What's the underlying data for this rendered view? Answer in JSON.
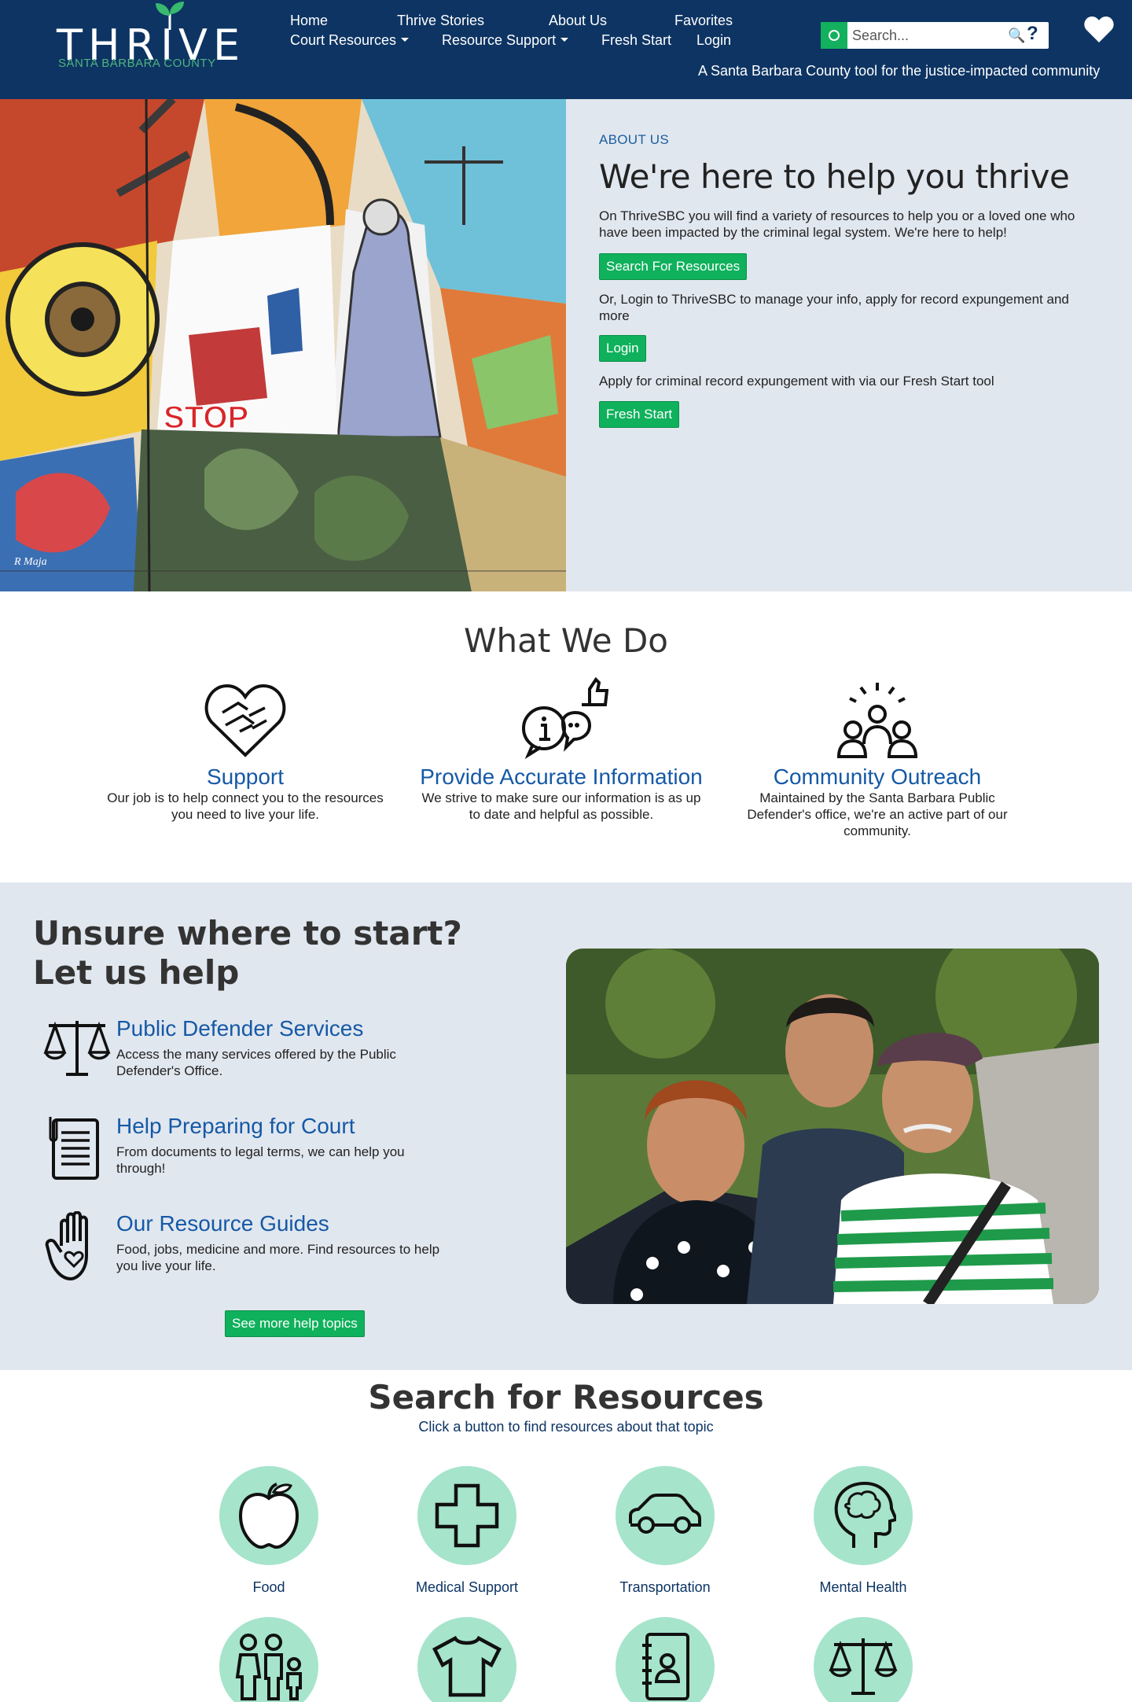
{
  "header": {
    "logo_word": "THRIVE",
    "logo_sub": "SANTA BARBARA COUNTY",
    "nav": {
      "home": "Home",
      "thrive_stories": "Thrive Stories",
      "about_us": "About Us",
      "favorites": "Favorites",
      "court_resources": "Court Resources",
      "resource_support": "Resource Support",
      "fresh_start": "Fresh Start",
      "login": "Login"
    },
    "search_placeholder": "Search...",
    "help_label": "?",
    "tagline": "A Santa Barbara County tool for the justice-impacted community"
  },
  "hero": {
    "mural_text": "STOP",
    "mural_signature": "R Maja",
    "eyebrow": "ABOUT US",
    "title": "We're here to help you thrive",
    "p1": "On ThriveSBC you will find a variety of resources to help you or a loved one who have been impacted by the criminal legal system. We're here to help!",
    "btn_search": "Search For Resources",
    "p2": "Or, Login to ThriveSBC to manage your info, apply for record expungement and more",
    "btn_login": "Login",
    "p3": "Apply for criminal record expungement with via our Fresh Start tool",
    "btn_fresh": "Fresh Start"
  },
  "what_we_do": {
    "title": "What We Do",
    "items": [
      {
        "heading": "Support",
        "text": "Our job is to help connect you to the resources you need to live your life.",
        "icon": "heart-hands-icon"
      },
      {
        "heading": "Provide Accurate Information",
        "text": "We strive to make sure our information is as up to date and helpful as possible.",
        "icon": "info-thumbs-up-icon"
      },
      {
        "heading": "Community Outreach",
        "text": "Maintained by the Santa Barbara Public Defender's office, we're an active part of our community.",
        "icon": "community-people-icon"
      }
    ]
  },
  "unsure": {
    "title_line1": "Unsure where to start?",
    "title_line2": "Let us help",
    "items": [
      {
        "heading": "Public Defender Services",
        "text": "Access the many services offered by the Public Defender's Office.",
        "icon": "scales-icon"
      },
      {
        "heading": "Help Preparing for Court",
        "text": "From documents to legal terms, we can help you through!",
        "icon": "document-icon"
      },
      {
        "heading": "Our Resource Guides",
        "text": "Food, jobs, medicine and more. Find resources to help you live your life.",
        "icon": "hand-heart-icon"
      }
    ],
    "btn_more": "See more help topics"
  },
  "resources": {
    "title": "Search for Resources",
    "subtitle": "Click a button to find resources about that topic",
    "items": [
      {
        "label": "Food",
        "icon": "apple-icon"
      },
      {
        "label": "Medical Support",
        "icon": "medical-cross-icon"
      },
      {
        "label": "Transportation",
        "icon": "car-icon"
      },
      {
        "label": "Mental Health",
        "icon": "brain-head-icon"
      },
      {
        "label": "",
        "icon": "family-icon"
      },
      {
        "label": "",
        "icon": "shirt-icon"
      },
      {
        "label": "",
        "icon": "address-book-icon"
      },
      {
        "label": "",
        "icon": "scales-icon"
      }
    ]
  },
  "colors": {
    "header_bg": "#0d3463",
    "accent_green": "#0fb15c",
    "link_blue": "#1559a6",
    "section_bg": "#e1e7ef",
    "icon_circle": "#a6e4cc"
  }
}
